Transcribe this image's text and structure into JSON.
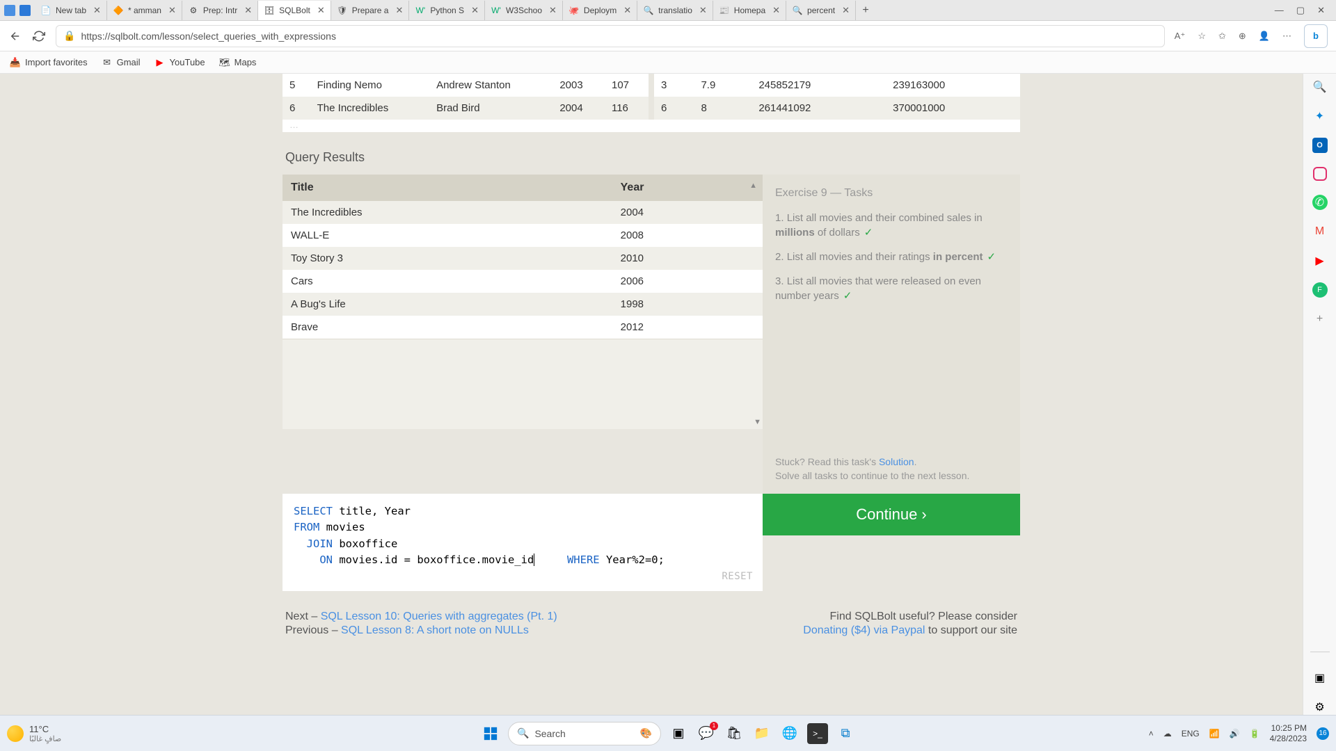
{
  "tabs": [
    {
      "label": "New tab"
    },
    {
      "label": "* amman"
    },
    {
      "label": "Prep: Intr"
    },
    {
      "label": "SQLBolt"
    },
    {
      "label": "Prepare a"
    },
    {
      "label": "Python S"
    },
    {
      "label": "W3Schoo"
    },
    {
      "label": "Deploym"
    },
    {
      "label": "translatio"
    },
    {
      "label": "Homepa"
    },
    {
      "label": "percent"
    }
  ],
  "url": "https://sqlbolt.com/lesson/select_queries_with_expressions",
  "bookmarks": {
    "import": "Import favorites",
    "gmail": "Gmail",
    "youtube": "YouTube",
    "maps": "Maps"
  },
  "top_table": {
    "rows": [
      [
        "5",
        "Finding Nemo",
        "Andrew Stanton",
        "2003",
        "107",
        "3",
        "7.9",
        "245852179",
        "239163000"
      ],
      [
        "6",
        "The Incredibles",
        "Brad Bird",
        "2004",
        "116",
        "6",
        "8",
        "261441092",
        "370001000"
      ]
    ]
  },
  "query_results": {
    "title": "Query Results",
    "headers": [
      "Title",
      "Year"
    ],
    "rows": [
      [
        "The Incredibles",
        "2004"
      ],
      [
        "WALL-E",
        "2008"
      ],
      [
        "Toy Story 3",
        "2010"
      ],
      [
        "Cars",
        "2006"
      ],
      [
        "A Bug's Life",
        "1998"
      ],
      [
        "Brave",
        "2012"
      ]
    ]
  },
  "tasks": {
    "heading": "Exercise 9 — Tasks",
    "items": [
      {
        "num": "1.",
        "pre": "List all movies and their combined sales in ",
        "em": "millions",
        "post": " of dollars"
      },
      {
        "num": "2.",
        "pre": "List all movies and their ratings ",
        "em": "in percent",
        "post": ""
      },
      {
        "num": "3.",
        "pre": "List all movies that were released on even number years",
        "em": "",
        "post": ""
      }
    ],
    "stuck_pre": "Stuck? Read this task's ",
    "stuck_link": "Solution",
    "stuck_post": ".",
    "solve_msg": "Solve all tasks to continue to the next lesson."
  },
  "sql": {
    "l1a": "SELECT",
    "l1b": " title, Year",
    "l2a": "FROM",
    "l2b": " movies",
    "l3a": "JOIN",
    "l3b": " boxoffice",
    "l4a": "ON",
    "l4b": " movies.id = boxoffice.movie_id",
    "l4c": "WHERE",
    "l4d": " Year%2=0;"
  },
  "reset": "RESET",
  "continue": "Continue ›",
  "footer": {
    "next_pre": "Next – ",
    "next_link": "SQL Lesson 10: Queries with aggregates (Pt. 1)",
    "prev_pre": "Previous – ",
    "prev_link": "SQL Lesson 8: A short note on NULLs",
    "useful": "Find SQLBolt useful? Please consider",
    "donate": "Donating ($4) via Paypal",
    "donate_post": " to support our site"
  },
  "weather": {
    "temp": "11°C",
    "desc": "صافٍ غالبًا"
  },
  "search": "Search",
  "tray": {
    "lang": "ENG",
    "time": "10:25 PM",
    "date": "4/28/2023",
    "count": "16"
  }
}
